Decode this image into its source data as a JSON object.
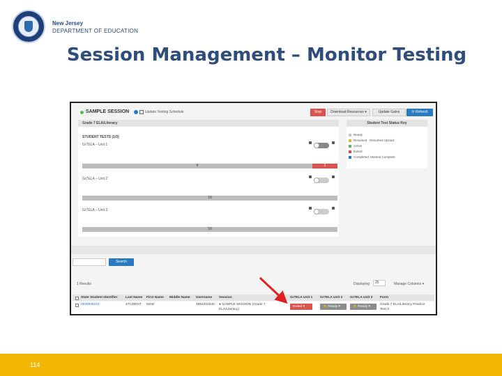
{
  "header": {
    "agency_line1": "New Jersey",
    "agency_line2": "DEPARTMENT OF EDUCATION",
    "title": "Session Management – Monitor Testing"
  },
  "session": {
    "name": "SAMPLE SESSION",
    "schedule_link": "Update Testing Schedule",
    "buttons": {
      "stop": "Stop",
      "download": "Download Resources ▾",
      "update": "Update Gains",
      "refresh": "⟳ Refresh"
    },
    "panel_title": "Grade 7 ELA/Literacy",
    "student_tests_label": "STUDENT TESTS (1/0)",
    "units": [
      {
        "label": "Gr7ELA – Unit 1",
        "bar_text": "6",
        "red_text": "1"
      },
      {
        "label": "Gr7ELA – Unit 2",
        "bar_text": "10"
      },
      {
        "label": "Gr7ELA – Unit 3",
        "bar_text": "10"
      }
    ]
  },
  "status_key": {
    "title": "Student Test Status Key",
    "items": [
      {
        "label": "Ready",
        "color": "#c8c8c8"
      },
      {
        "label": "Resumed · Resumed Upload",
        "color": "#f0ad4e"
      },
      {
        "label": "Active",
        "color": "#5cb85c"
      },
      {
        "label": "Exited",
        "color": "#d9534f"
      },
      {
        "label": "Completed, Marked Complete",
        "color": "#2a7ac0"
      }
    ]
  },
  "search": {
    "button": "Search"
  },
  "table": {
    "results": "1 Results",
    "displaying_label": "Displaying",
    "displaying_value": "25",
    "manage_columns": "Manage Columns ▾",
    "headers": [
      "State Student Identifier",
      "Last Name",
      "First Name",
      "Middle Name",
      "Username",
      "Session",
      "Gr7ELA Unit 1",
      "Gr7ELA Unit 2",
      "Gr7ELA Unit 3",
      "Form"
    ],
    "row": {
      "ssid": "0825946224",
      "last": "STUDENT",
      "first": "NEW",
      "middle": "",
      "username": "4964201540",
      "session_line1": "● SAMPLE SESSION (Grade 7",
      "session_line2": "ELA/Literacy)",
      "unit1": "Exited ▾",
      "unit2": "🔒 Ready ▾",
      "unit3": "🔒 Ready ▾",
      "form_line1": "Grade 7 ELA/Literacy Practice",
      "form_line2": "Test 3"
    }
  },
  "footer": {
    "page_number": "114"
  }
}
